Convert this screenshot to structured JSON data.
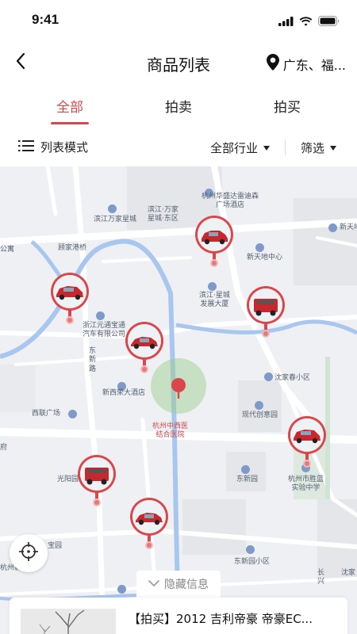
{
  "status_bar": {
    "time": "9:41"
  },
  "nav": {
    "title": "商品列表",
    "location": "广东、福..."
  },
  "tabs": [
    {
      "label": "全部",
      "active": true
    },
    {
      "label": "拍卖",
      "active": false
    },
    {
      "label": "拍买",
      "active": false
    }
  ],
  "toolbar": {
    "list_mode": "列表模式",
    "industry": "全部行业",
    "filter": "筛选"
  },
  "map": {
    "labels": {
      "binjiang_wanjia": "滨江万家星城",
      "binjiang_wanjia_east": "滨江·万家\n星城·东区",
      "huasheng_hotel": "杭州华盛达雷迪森\n广场酒店",
      "xintiandi": "新天地",
      "xintiandi_center": "新天地中心",
      "binjiang_xingcheng": "滨江·星城\n发展大厦",
      "gujiagang": "顾家港桥",
      "zhejiang_yuantong": "浙江元通宝通\n汽车有限公司",
      "dongxin_road": "东新路",
      "xinxi_hotel": "新西荣大酒店",
      "xilian_plaza": "西联广场",
      "zhongxiyi_hospital": "杭州中西医\n结合医院",
      "shenjiaqiao": "沈家春小区",
      "xiandai_chuangyi": "现代创意园",
      "guangyang": "光阳园",
      "dongxinyuan": "东新园",
      "shengli_school": "杭州市胜蓝\n实验中学",
      "dongxinyuan_xiaoqu": "东新园小区",
      "changhe": "长\n兴",
      "shenjia": "沈家",
      "baoguan": "宝园",
      "hangzhou_xin": "杭州新力",
      "gongyu": "公寓",
      "fu": "府"
    }
  },
  "hide_info": "隐藏信息",
  "card": {
    "title": "【拍买】2012 吉利帝豪 帝豪EC..."
  },
  "colors": {
    "accent": "#d9474b",
    "map_bg": "#eef0f3",
    "river": "#a9c6ee"
  }
}
